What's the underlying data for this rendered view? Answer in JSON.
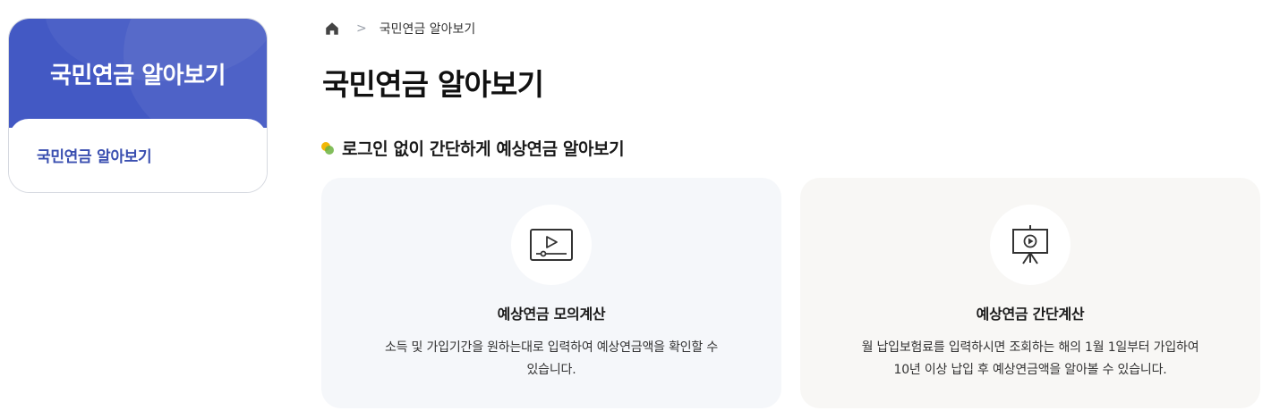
{
  "sidebar": {
    "title": "국민연금 알아보기",
    "items": [
      {
        "label": "국민연금 알아보기"
      }
    ]
  },
  "breadcrumb": {
    "home_icon": "home-icon",
    "separator": ">",
    "current": "국민연금 알아보기"
  },
  "page": {
    "title": "국민연금 알아보기"
  },
  "section": {
    "icon": "colored-dot-icon",
    "title": "로그인 없이 간단하게 예상연금 알아보기"
  },
  "cards": [
    {
      "icon": "video-player-icon",
      "title": "예상연금 모의계산",
      "desc_line1": "소득 및 가입기간을 원하는대로 입력하여 예상연금액을 확인할 수",
      "desc_line2": "있습니다."
    },
    {
      "icon": "presentation-board-icon",
      "title": "예상연금 간단계산",
      "desc_line1": "월 납입보험료를 입력하시면 조회하는 해의 1월 1일부터 가입하여",
      "desc_line2": "10년 이상 납입 후 예상연금액을 알아볼 수 있습니다."
    }
  ],
  "colors": {
    "brand": "#4359c4",
    "sidebar_active": "#3a4fb0",
    "dot_yellow": "#f2b705",
    "dot_green": "#6cb33f"
  }
}
